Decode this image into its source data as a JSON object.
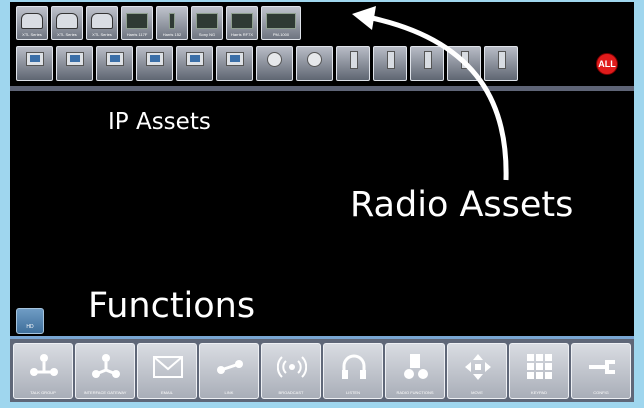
{
  "radio_assets": [
    {
      "caption": "XTL Series",
      "icon": "phone-icon"
    },
    {
      "caption": "XTL Series",
      "icon": "phone-icon"
    },
    {
      "caption": "XTL Series",
      "icon": "phone-icon"
    },
    {
      "caption": "Harris 117F",
      "icon": "radio-unit-icon"
    },
    {
      "caption": "Harris 152",
      "icon": "handheld-radio-icon"
    },
    {
      "caption": "Sony NG",
      "icon": "radio-unit-icon"
    },
    {
      "caption": "Harris RF7X",
      "icon": "radio-unit-icon"
    },
    {
      "caption": "PM-1000",
      "icon": "radio-unit-icon"
    }
  ],
  "ip_assets": [
    {
      "caption": "",
      "icon": "computer-icon"
    },
    {
      "caption": "",
      "icon": "computer-icon"
    },
    {
      "caption": "",
      "icon": "computer-icon"
    },
    {
      "caption": "",
      "icon": "computer-icon"
    },
    {
      "caption": "",
      "icon": "computer-icon"
    },
    {
      "caption": "",
      "icon": "computer-icon"
    },
    {
      "caption": "",
      "icon": "camera-icon"
    },
    {
      "caption": "",
      "icon": "camera-icon"
    },
    {
      "caption": "",
      "icon": "handheld-radio-icon"
    },
    {
      "caption": "",
      "icon": "handheld-radio-icon"
    },
    {
      "caption": "",
      "icon": "handheld-radio-icon"
    },
    {
      "caption": "",
      "icon": "handheld-radio-icon"
    },
    {
      "caption": "",
      "icon": "handheld-radio-icon"
    }
  ],
  "all_button": "ALL",
  "labels": {
    "ip_assets": "IP Assets",
    "radio_assets": "Radio Assets",
    "functions": "Functions"
  },
  "small_button": {
    "caption": "HD"
  },
  "functions": [
    {
      "caption": "TALK GROUP",
      "icon": "talk-group-icon"
    },
    {
      "caption": "INTERFACE GATEWAY",
      "icon": "gateway-icon"
    },
    {
      "caption": "EMAIL",
      "icon": "envelope-icon"
    },
    {
      "caption": "LINK",
      "icon": "link-icon"
    },
    {
      "caption": "BROADCAST",
      "icon": "broadcast-icon"
    },
    {
      "caption": "LISTEN",
      "icon": "headset-icon"
    },
    {
      "caption": "RADIO FUNCTIONS",
      "icon": "speaker-icon"
    },
    {
      "caption": "MOVE",
      "icon": "move-arrows-icon"
    },
    {
      "caption": "KEYPAD",
      "icon": "keypad-icon"
    },
    {
      "caption": "CONFIG",
      "icon": "wrench-icon"
    }
  ],
  "colors": {
    "background": "#9fd6ee",
    "screen": "#000000",
    "all_button": "#e01b1b",
    "function_bar_accent": "#79a6d3"
  }
}
